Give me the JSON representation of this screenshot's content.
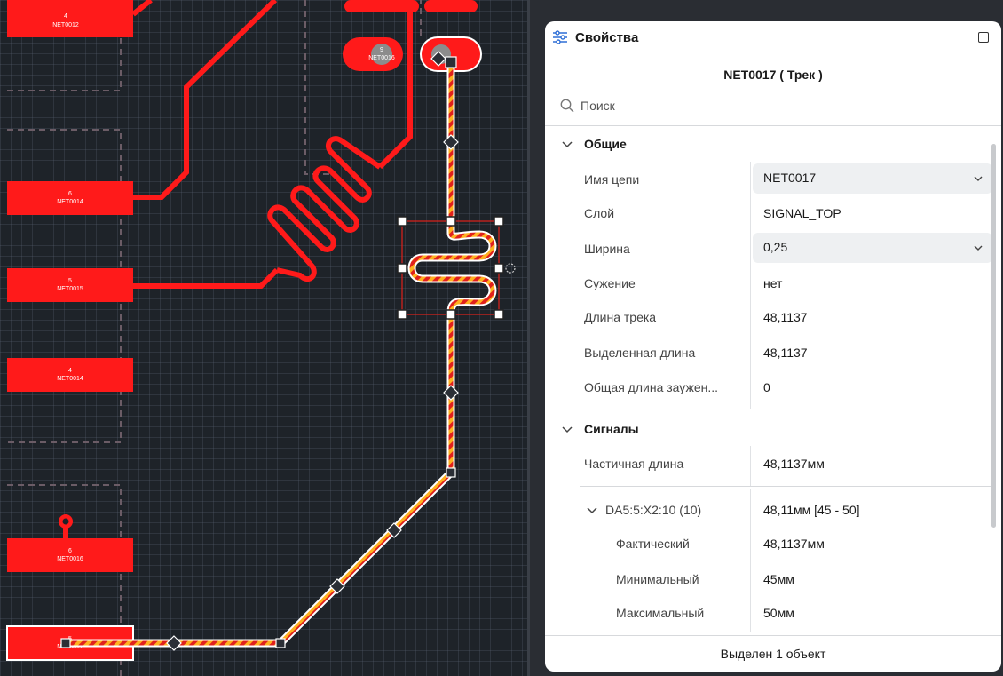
{
  "canvas": {
    "pads": [
      {
        "num": "4",
        "net": "NET0012"
      },
      {
        "num": "6",
        "net": "NET0014"
      },
      {
        "num": "5",
        "net": "NET0015"
      },
      {
        "num": "4",
        "net": "NET0014"
      },
      {
        "num": "6",
        "net": "NET0016"
      },
      {
        "num": "5",
        "net": "NET0017"
      }
    ],
    "round_pads": [
      {
        "num": "9",
        "net": "NET0016"
      }
    ],
    "colors": {
      "trace": "#ff1a1a",
      "selected_dash_a": "#ffb11f",
      "selected_dash_b": "#e0211c",
      "grid_bg": "#1e2329",
      "guide_dash": "#6b5c66"
    }
  },
  "panel": {
    "title": "Свойства",
    "title_icon": "sliders-icon",
    "maximize_icon": "maximize-icon",
    "subtitle": "NET0017 ( Трек )",
    "search_placeholder": "Поиск",
    "sections": {
      "general": {
        "title": "Общие",
        "net_name_label": "Имя цепи",
        "net_name_value": "NET0017",
        "layer_label": "Слой",
        "layer_value": "SIGNAL_TOP",
        "width_label": "Ширина",
        "width_value": "0,25",
        "taper_label": "Сужение",
        "taper_value": "нет",
        "track_length_label": "Длина трека",
        "track_length_value": "48,1137",
        "selected_length_label": "Выделенная длина",
        "selected_length_value": "48,1137",
        "total_narrow_label": "Общая длина заужен...",
        "total_narrow_value": "0"
      },
      "signals": {
        "title": "Сигналы",
        "partial_length_label": "Частичная длина",
        "partial_length_value": "48,1137мм",
        "signal_name": "DA5:5:X2:10 (10)",
        "signal_value": "48,11мм [45 - 50]",
        "actual_label": "Фактический",
        "actual_value": "48,1137мм",
        "min_label": "Минимальный",
        "min_value": "45мм",
        "max_label": "Максимальный",
        "max_value": "50мм"
      }
    },
    "footer": "Выделен 1 объект"
  }
}
